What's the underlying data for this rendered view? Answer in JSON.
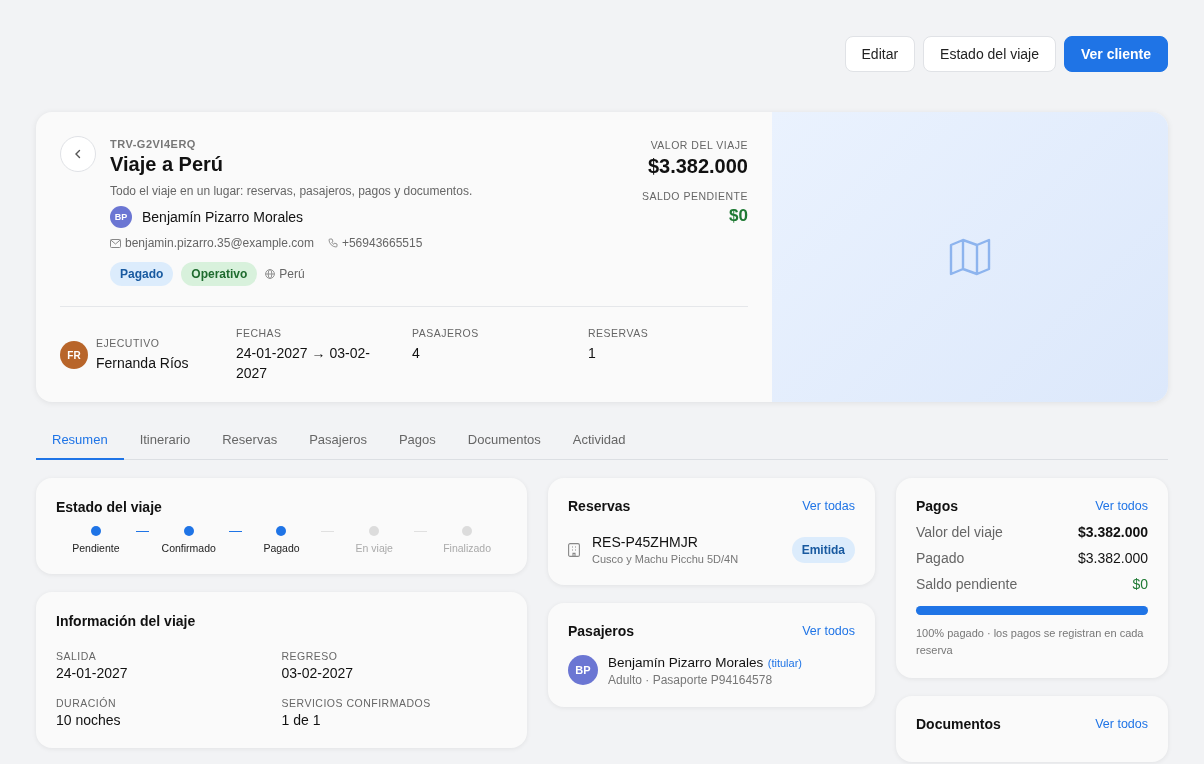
{
  "header_actions": [
    {
      "label": "Editar",
      "kind": "secondary"
    },
    {
      "label": "Estado del viaje",
      "kind": "secondary"
    },
    {
      "label": "Ver cliente",
      "kind": "primary"
    }
  ],
  "trip": {
    "code": "TRV-G2VI4ERQ",
    "title": "Viaje a Perú",
    "subtitle": "Todo el viaje en un lugar: reservas, pasajeros, pagos y documentos.",
    "client": {
      "initials": "BP",
      "color": "#6b76d3",
      "name": "Benjamín Pizarro Morales",
      "email": "benjamin.pizarro.35@example.com",
      "phone": "+56943665515"
    },
    "badges": [
      {
        "label": "Pagado",
        "kind": "info"
      },
      {
        "label": "Operativo",
        "kind": "success"
      }
    ],
    "country": "Perú",
    "value_label": "VALOR DEL VIAJE",
    "value": "$3.382.000",
    "balance_label": "SALDO PENDIENTE",
    "balance": "$0",
    "executive": {
      "initials": "FR",
      "color": "#b8652a",
      "label": "EJECUTIVO",
      "name": "Fernanda Ríos"
    },
    "stats": [
      {
        "label": "FECHAS",
        "value": "24-01-2027 → 03-02-2027"
      },
      {
        "label": "PASAJEROS",
        "value": "4"
      },
      {
        "label": "RESERVAS",
        "value": "1"
      }
    ]
  },
  "tabs": [
    {
      "label": "Resumen",
      "selected": true
    },
    {
      "label": "Itinerario",
      "selected": false
    },
    {
      "label": "Reservas",
      "selected": false
    },
    {
      "label": "Pasajeros",
      "selected": false
    },
    {
      "label": "Pagos",
      "selected": false
    },
    {
      "label": "Documentos",
      "selected": false
    },
    {
      "label": "Actividad",
      "selected": false
    }
  ],
  "status_card": {
    "title": "Estado del viaje",
    "steps": [
      {
        "label": "Pendiente",
        "done": true
      },
      {
        "label": "Confirmado",
        "done": true
      },
      {
        "label": "Pagado",
        "done": true
      },
      {
        "label": "En viaje",
        "done": false
      },
      {
        "label": "Finalizado",
        "done": false
      }
    ]
  },
  "info_card": {
    "title": "Información del viaje",
    "fields": [
      {
        "label": "SALIDA",
        "value": "24-01-2027"
      },
      {
        "label": "REGRESO",
        "value": "03-02-2027"
      },
      {
        "label": "DURACIÓN",
        "value": "10 noches"
      },
      {
        "label": "SERVICIOS CONFIRMADOS",
        "value": "1 de 1"
      }
    ]
  },
  "reservations_card": {
    "title": "Reservas",
    "link": "Ver todas",
    "items": [
      {
        "code": "RES-P45ZHMJR",
        "description": "Cusco y Machu Picchu 5D/4N",
        "status": "Emitida"
      }
    ]
  },
  "passengers_card": {
    "title": "Pasajeros",
    "link": "Ver todos",
    "items": [
      {
        "initials": "BP",
        "color": "#6b76d3",
        "name": "Benjamín Pizarro Morales",
        "tag": "(titular)",
        "detail": "Adulto · Pasaporte P94164578"
      }
    ]
  },
  "payments_card": {
    "title": "Pagos",
    "link": "Ver todos",
    "rows": [
      {
        "label": "Valor del viaje",
        "value": "$3.382.000",
        "kind": "total"
      },
      {
        "label": "Pagado",
        "value": "$3.382.000",
        "kind": "normal"
      },
      {
        "label": "Saldo pendiente",
        "value": "$0",
        "kind": "balance"
      }
    ],
    "level": 1,
    "note": "100% pagado · los pagos se registran en cada reserva"
  },
  "documents_card": {
    "title": "Documentos",
    "link": "Ver todos"
  }
}
